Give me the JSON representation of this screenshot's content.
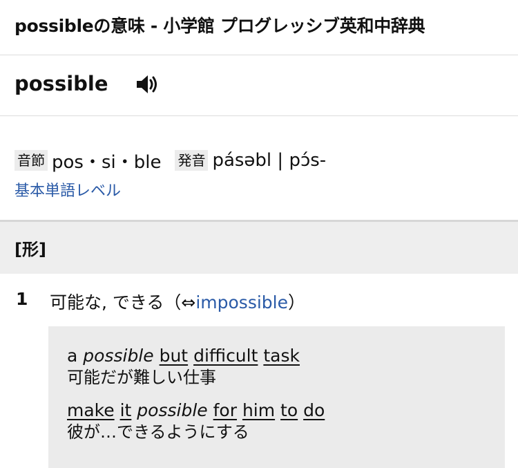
{
  "page": {
    "title": "possibleの意味 - 小学館 プログレッシブ英和中辞典"
  },
  "entry": {
    "headword": "possible",
    "audio_icon": "speaker-icon",
    "syllable_label": "音節",
    "syllables": "pos・si・ble",
    "pronunciation_label": "発音",
    "pronunciation": "pásəbl | pɔ́s-",
    "level_link": "基本単語レベル"
  },
  "part_of_speech": "[形]",
  "senses": [
    {
      "number": "1",
      "text": "可能な, できる（⇔",
      "link": "impossible",
      "close": "）",
      "examples": [
        {
          "english": [
            {
              "text": "a",
              "style": "plain"
            },
            {
              "text": "possible",
              "style": "italic"
            },
            {
              "text": "but",
              "style": "link"
            },
            {
              "text": "difficult",
              "style": "link"
            },
            {
              "text": "task",
              "style": "link"
            }
          ],
          "japanese": "可能だが難しい仕事"
        },
        {
          "english": [
            {
              "text": "make",
              "style": "link"
            },
            {
              "text": "it",
              "style": "link"
            },
            {
              "text": "possible",
              "style": "italic"
            },
            {
              "text": "for",
              "style": "link"
            },
            {
              "text": "him",
              "style": "link"
            },
            {
              "text": "to",
              "style": "link"
            },
            {
              "text": "do",
              "style": "link"
            }
          ],
          "japanese": "彼が…できるようにする"
        }
      ]
    }
  ]
}
